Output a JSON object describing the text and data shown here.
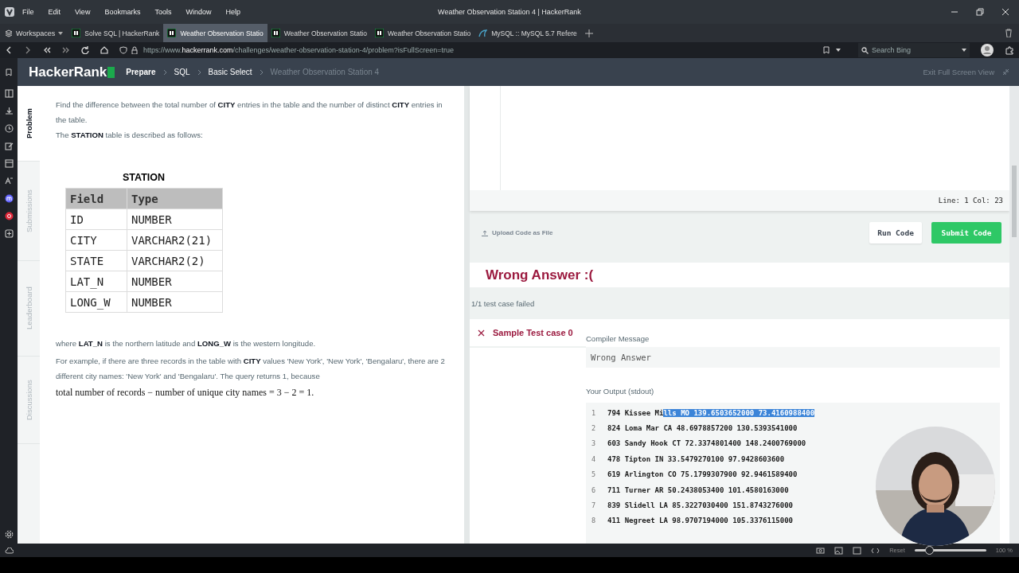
{
  "window": {
    "title": "Weather Observation Station 4 | HackerRank"
  },
  "menu": [
    "File",
    "Edit",
    "View",
    "Bookmarks",
    "Tools",
    "Window",
    "Help"
  ],
  "browser": {
    "workspaces": "Workspaces",
    "tabs": [
      {
        "label": "Solve SQL | HackerRank",
        "selected": false
      },
      {
        "label": "Weather Observation Statio",
        "selected": true
      },
      {
        "label": "Weather Observation Statio",
        "selected": false
      },
      {
        "label": "Weather Observation Statio",
        "selected": false
      },
      {
        "label": "MySQL :: MySQL 5.7 Refere",
        "selected": false,
        "kind": "mysql"
      }
    ],
    "url": "https://www.**hackerrank.com**/challenges/weather-observation-station-4/problem?isFullScreen=true",
    "search": {
      "placeholder": "Search Bing"
    }
  },
  "header": {
    "logo": "HackerRank",
    "breadcrumbs": [
      {
        "label": "Prepare",
        "current": false
      },
      {
        "label": "SQL",
        "current": false
      },
      {
        "label": "Basic Select",
        "current": false
      },
      {
        "label": "Weather Observation Station 4",
        "current": true
      }
    ],
    "exit": "Exit Full Screen View"
  },
  "problem_tabs": [
    {
      "label": "Problem",
      "selected": true
    },
    {
      "label": "Submissions",
      "selected": false
    },
    {
      "label": "Leaderboard",
      "selected": false
    },
    {
      "label": "Discussions",
      "selected": false
    }
  ],
  "problem": {
    "intro": "Find the difference between the total number of **CITY** entries in the table and the number of distinct **CITY** entries in the table.",
    "described": "The **STATION** table is described as follows:",
    "table": {
      "title": "STATION",
      "columns": [
        "Field",
        "Type"
      ],
      "rows": [
        [
          "ID",
          "NUMBER"
        ],
        [
          "CITY",
          "VARCHAR2(21)"
        ],
        [
          "STATE",
          "VARCHAR2(2)"
        ],
        [
          "LAT_N",
          "NUMBER"
        ],
        [
          "LONG_W",
          "NUMBER"
        ]
      ]
    },
    "where": "where **LAT_N** is the northern latitude and **LONG_W** is the western longitude.",
    "example": "For example, if there are three records in the table with **CITY** values 'New York', 'New York', 'Bengalaru', there are 2 different city names: 'New York' and 'Bengalaru'. The query returns 1, because",
    "formula": "total number of records − number of unique city names = 3 − 2 = 1."
  },
  "editor": {
    "position": "Line: 1 Col: 23",
    "upload": "Upload Code as File",
    "run": "Run Code",
    "submit": "Submit Code"
  },
  "results": {
    "verdict": "Wrong Answer :(",
    "summary": "1/1 test case failed",
    "test_cases": [
      {
        "label": "Sample Test case 0",
        "passed": false,
        "selected": true
      }
    ],
    "compiler_label": "Compiler Message",
    "compiler_message": "Wrong Answer",
    "output_label": "Your Output (stdout)",
    "output": [
      {
        "number": "1",
        "text": "794 Kissee Mi",
        "selected_text": "lls MO 139.6503652000 73.4160988400"
      },
      {
        "number": "2",
        "text": "824 Loma Mar CA 48.6978857200 130.5393541000"
      },
      {
        "number": "3",
        "text": "603 Sandy Hook CT 72.3374801400 148.2400769000"
      },
      {
        "number": "4",
        "text": "478 Tipton IN 33.5479270100 97.9428603600"
      },
      {
        "number": "5",
        "text": "619 Arlington CO 75.1799307900 92.9461589400"
      },
      {
        "number": "6",
        "text": "711 Turner AR 50.2438053400 101.4580163000"
      },
      {
        "number": "7",
        "text": "839 Slidell LA 85.3227030400 151.8743276000"
      },
      {
        "number": "8",
        "text": "411 Negreet LA 98.9707194000 105.3376115000"
      }
    ]
  },
  "webcam": {
    "kind": "picture"
  },
  "status_bar": {
    "reset": "Reset",
    "zoom": {
      "level": 0.2
    },
    "zoom_label": "100 %"
  }
}
